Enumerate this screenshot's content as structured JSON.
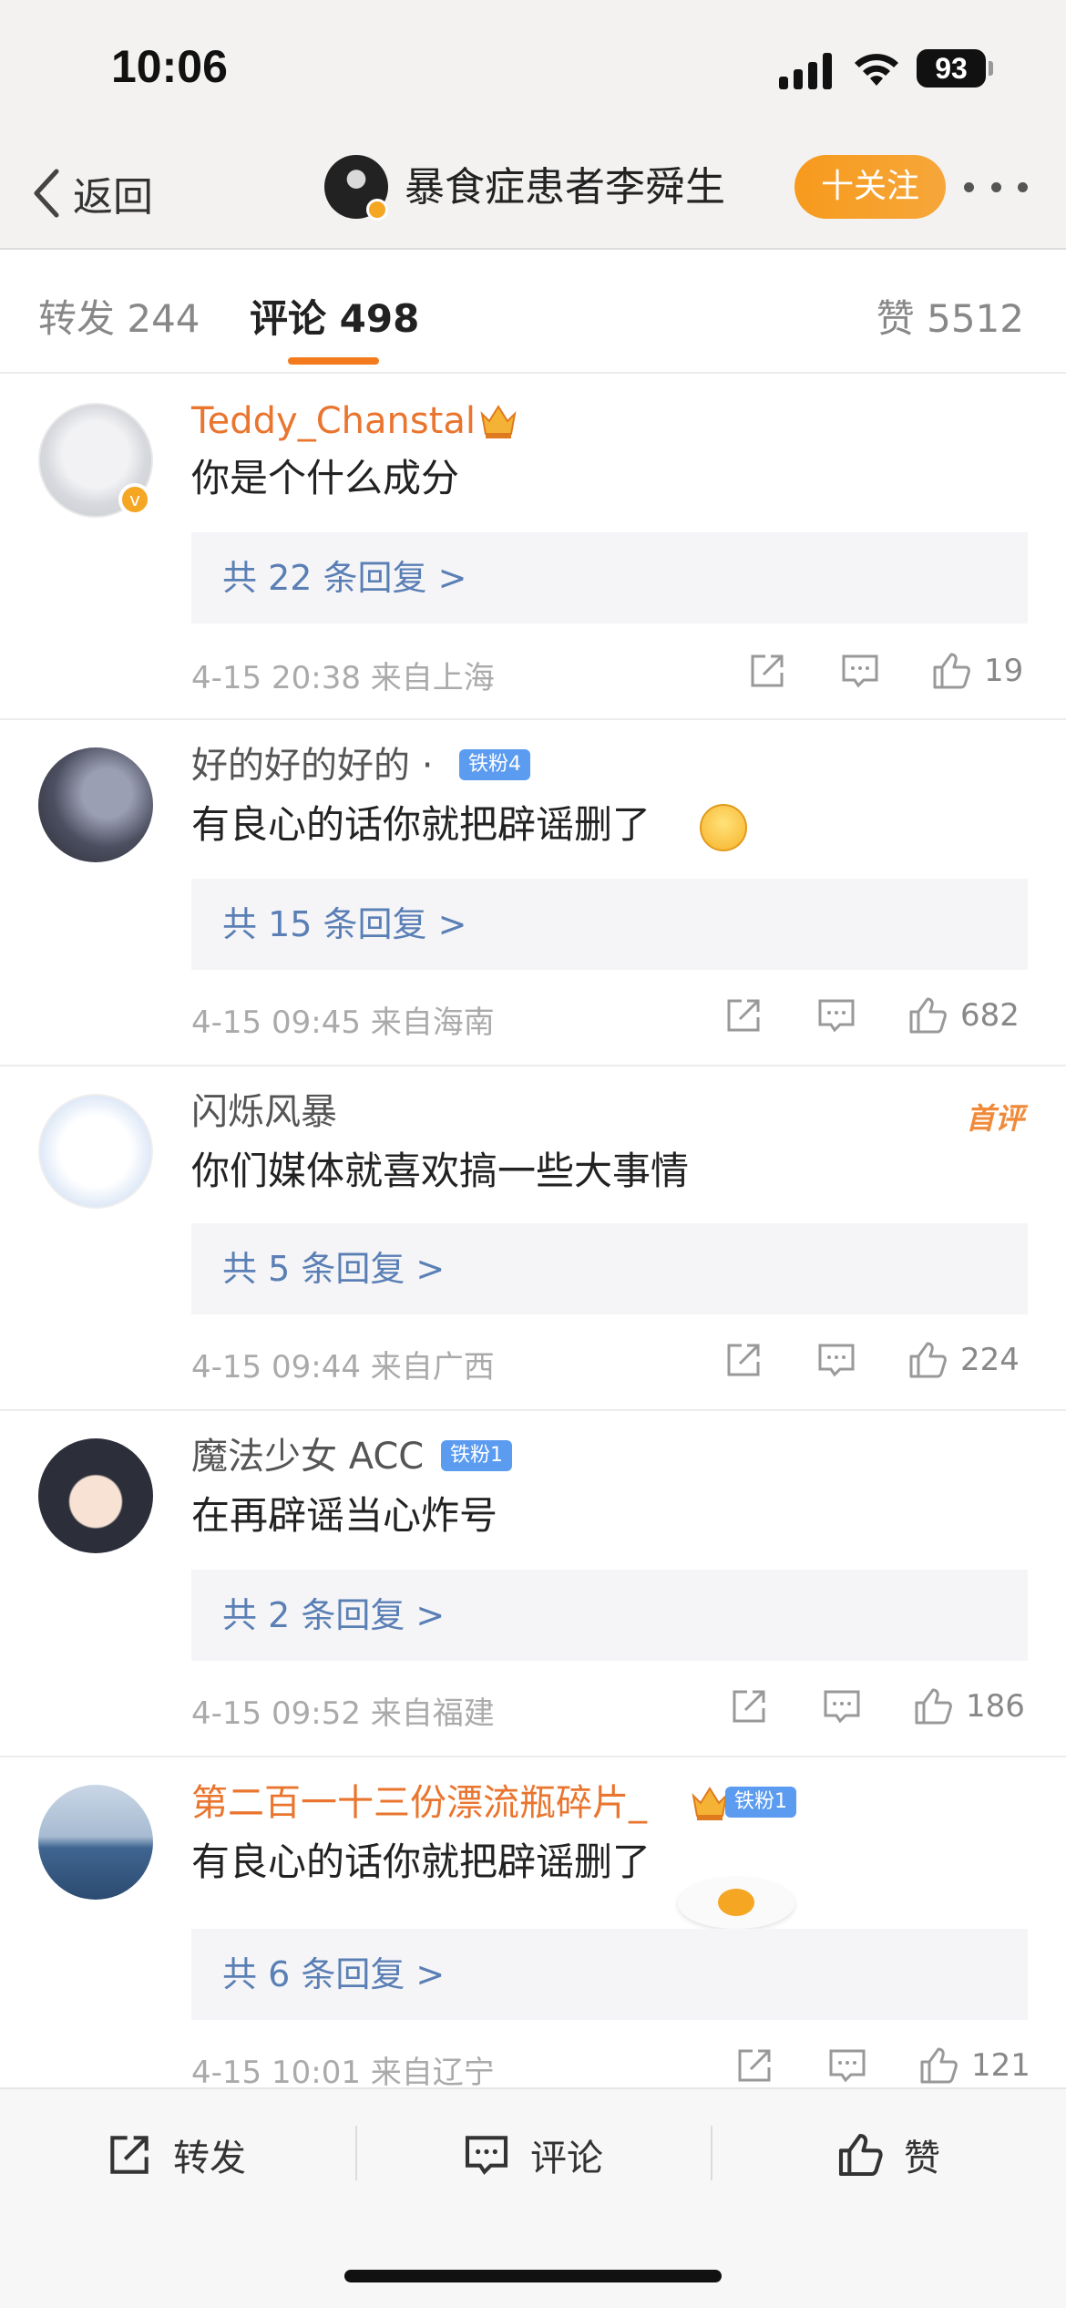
{
  "status_bar": {
    "time": "10:06",
    "battery": "93"
  },
  "nav": {
    "back_label": "返回",
    "title": "暴食症患者李舜生",
    "follow_label": "十关注"
  },
  "tabs": {
    "repost": "转发 244",
    "comments": "评论 498",
    "likes": "赞 5512"
  },
  "comments": [
    {
      "username": "Teddy_Chanstal",
      "text": "你是个什么成分",
      "replies": "共 22 条回复 >",
      "date": "4-15 20:38",
      "location": "来自上海",
      "likes": "19"
    },
    {
      "username": "好的好的好的 ·",
      "fan_badge": "铁粉4",
      "text": "有良心的话你就把辟谣删了",
      "replies": "共 15 条回复 >",
      "date": "4-15 09:45",
      "location": "来自海南",
      "likes": "682"
    },
    {
      "username": "闪烁风暴",
      "first_badge": "首评",
      "text": "你们媒体就喜欢搞一些大事情",
      "replies": "共 5 条回复 >",
      "date": "4-15 09:44",
      "location": "来自广西",
      "likes": "224"
    },
    {
      "username": "魔法少女 ACC",
      "fan_badge": "铁粉1",
      "text": "在再辟谣当心炸号",
      "replies": "共 2 条回复 >",
      "date": "4-15 09:52",
      "location": "来自福建",
      "likes": "186"
    },
    {
      "username": "第二百一十三份漂流瓶碎片_",
      "fan_badge": "铁粉1",
      "text": "有良心的话你就把辟谣删了",
      "replies": "共 6 条回复 >",
      "date": "4-15 10:01",
      "location": "来自辽宁",
      "likes": "121"
    }
  ],
  "bottom_bar": {
    "repost": "转发",
    "comment": "评论",
    "like": "赞"
  },
  "colors": {
    "accent_orange": "#f37b1d",
    "reply_link": "#5a7fb5",
    "vip_name": "#e9752f",
    "fan_badge": "#5b9bf0"
  },
  "icons": [
    "back-icon",
    "signal-icon",
    "wifi-icon",
    "battery-icon",
    "more-icon",
    "share-icon",
    "comment-icon",
    "like-icon",
    "crown-icon"
  ]
}
